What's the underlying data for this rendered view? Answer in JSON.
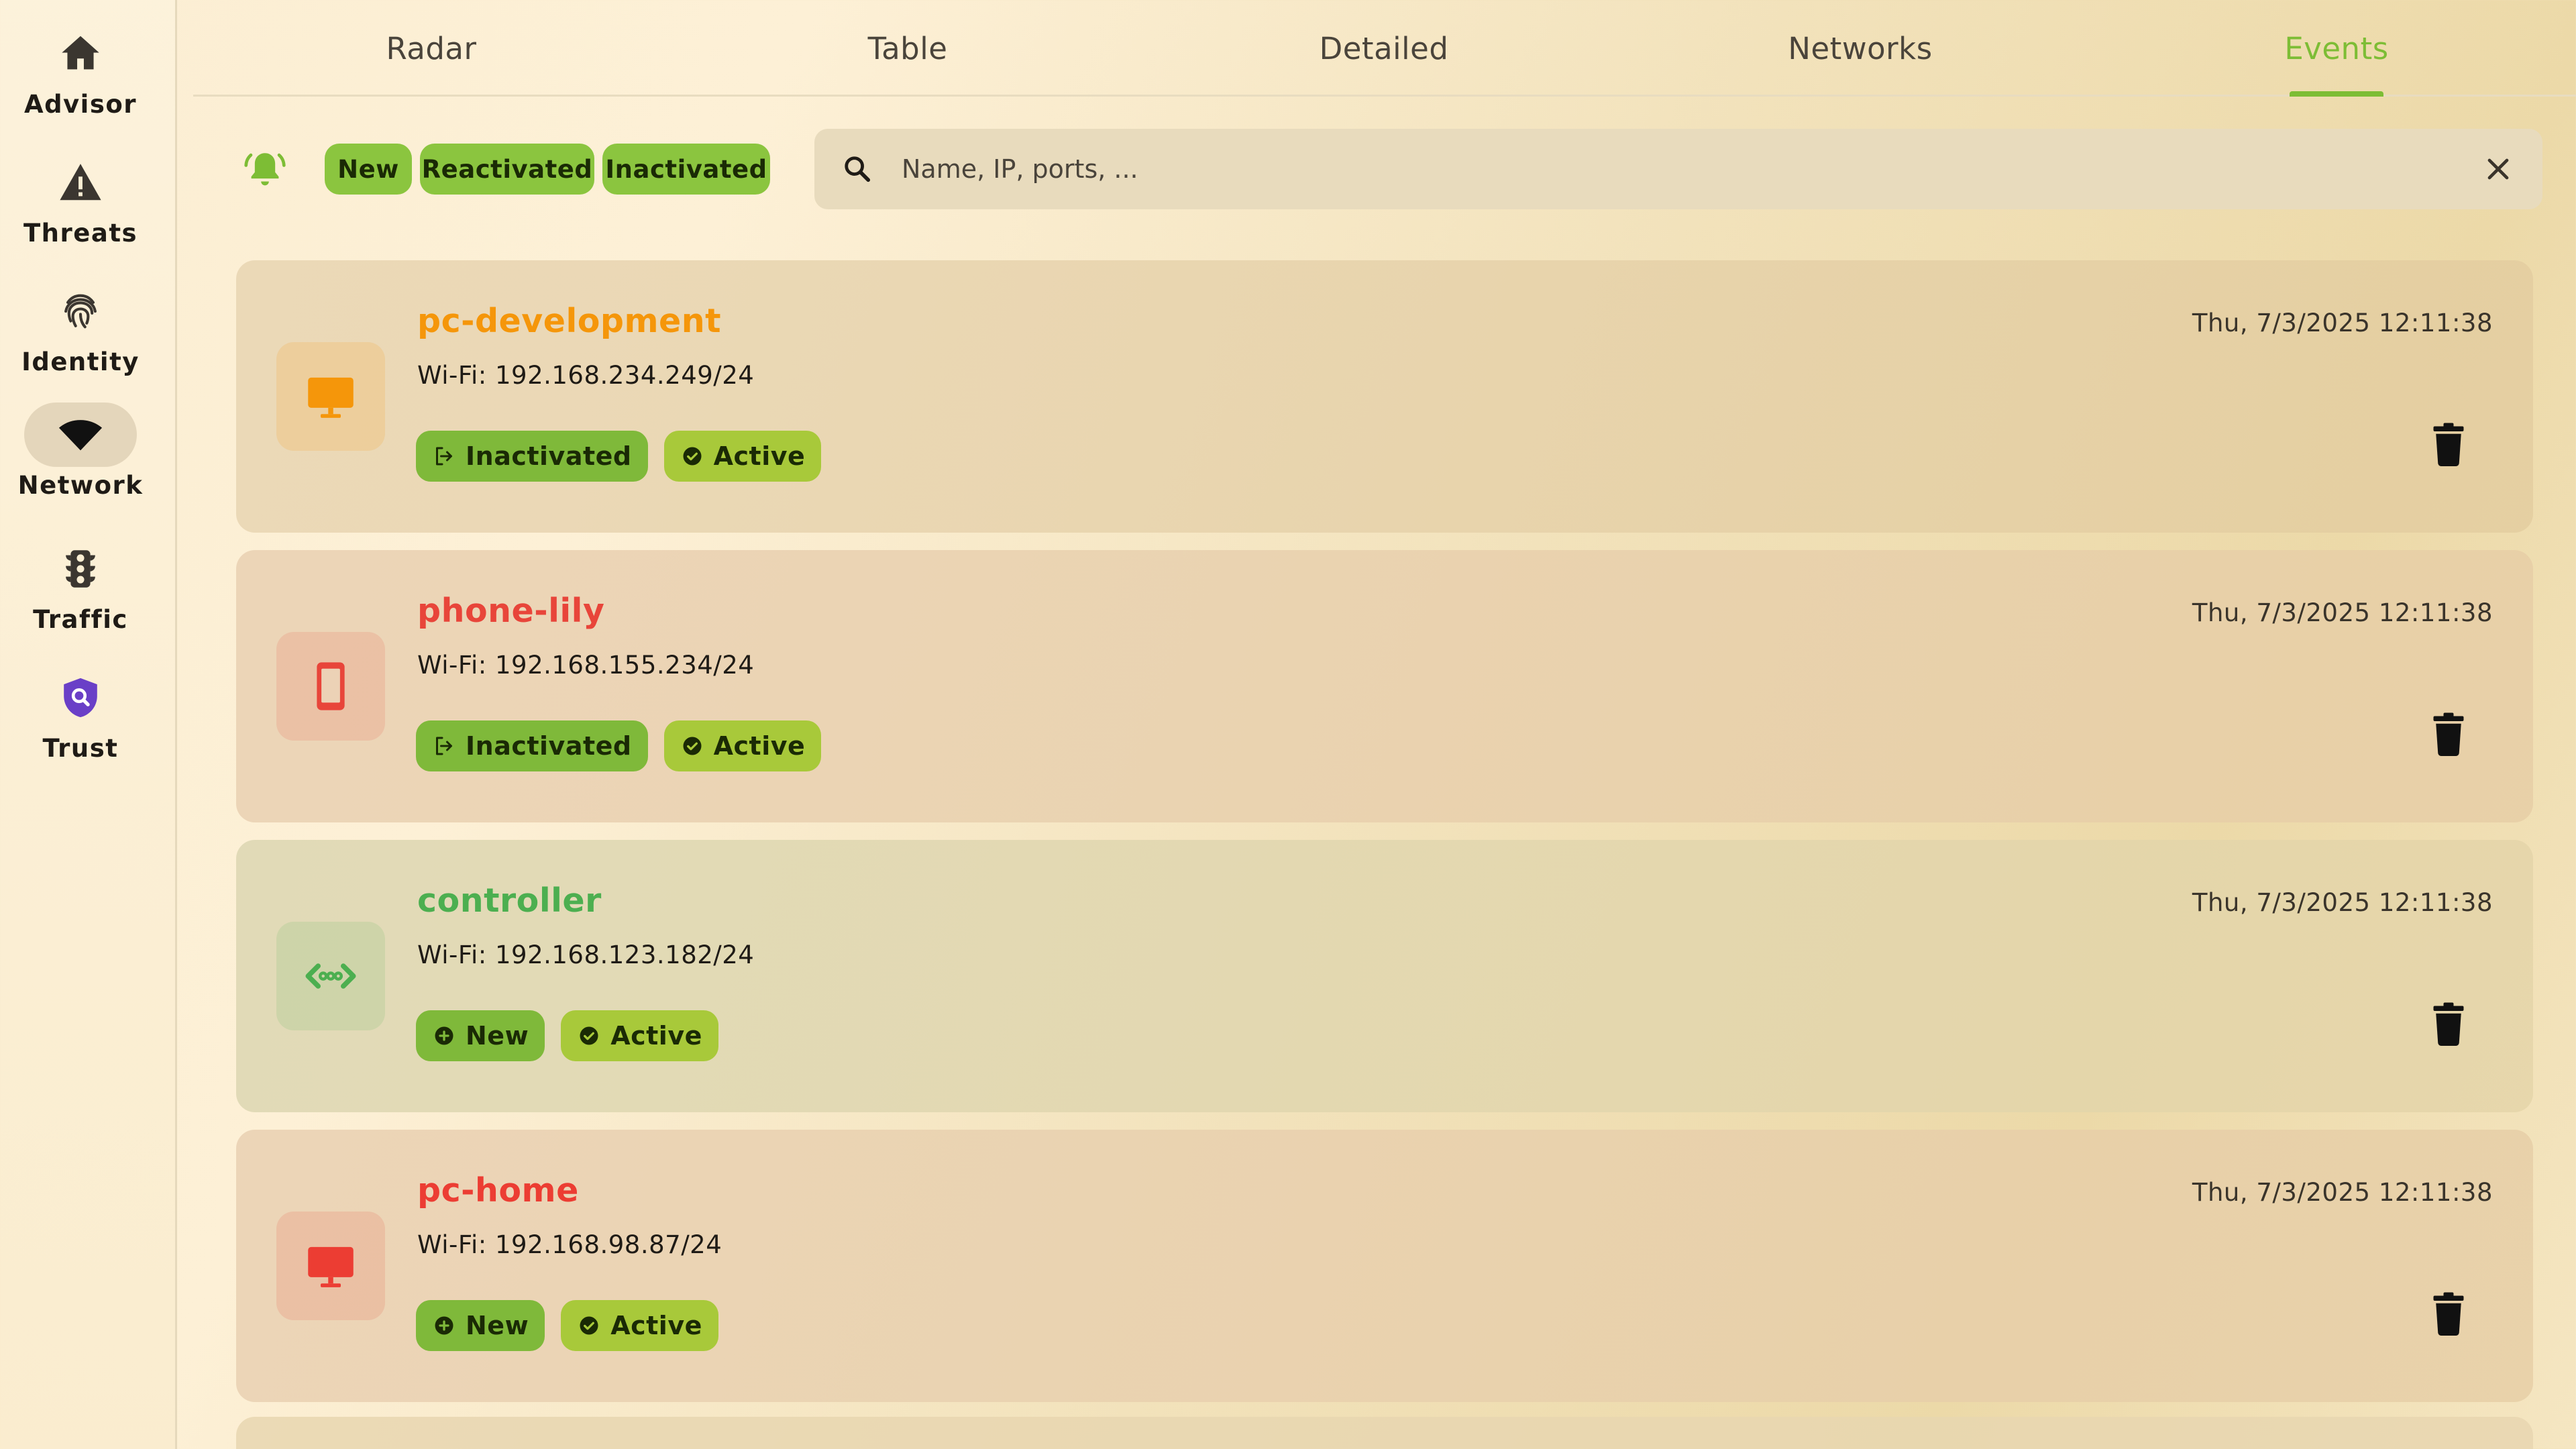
{
  "sidebar": {
    "items": [
      {
        "label": "Advisor",
        "icon": "home-icon"
      },
      {
        "label": "Threats",
        "icon": "warning-icon"
      },
      {
        "label": "Identity",
        "icon": "fingerprint-icon"
      },
      {
        "label": "Network",
        "icon": "wifi-icon",
        "active": true
      },
      {
        "label": "Traffic",
        "icon": "traffic-light-icon"
      },
      {
        "label": "Trust",
        "icon": "shield-search-icon"
      }
    ]
  },
  "tabs": [
    "Radar",
    "Table",
    "Detailed",
    "Networks",
    "Events"
  ],
  "active_tab": "Events",
  "filters": {
    "chips": [
      "New",
      "Reactivated",
      "Inactivated"
    ]
  },
  "search": {
    "placeholder": "Name, IP, ports, ...",
    "value": ""
  },
  "events": [
    {
      "name": "pc-development",
      "ip": "Wi-Fi: 192.168.234.249/24",
      "time": "Thu, 7/3/2025 12:11:38",
      "event_badge": "Inactivated",
      "status_badge": "Active",
      "device_icon": "desktop-icon",
      "color": "#f5960a"
    },
    {
      "name": "phone-lily",
      "ip": "Wi-Fi: 192.168.155.234/24",
      "time": "Thu, 7/3/2025 12:11:38",
      "event_badge": "Inactivated",
      "status_badge": "Active",
      "device_icon": "phone-icon",
      "color": "#e8453a"
    },
    {
      "name": "controller",
      "ip": "Wi-Fi: 192.168.123.182/24",
      "time": "Thu, 7/3/2025 12:11:38",
      "event_badge": "New",
      "status_badge": "Active",
      "device_icon": "code-arrows-icon",
      "color": "#4caf50"
    },
    {
      "name": "pc-home",
      "ip": "Wi-Fi: 192.168.98.87/24",
      "time": "Thu, 7/3/2025 12:11:38",
      "event_badge": "New",
      "status_badge": "Active",
      "device_icon": "desktop-icon",
      "color": "#ec3d33"
    }
  ],
  "colors": {
    "accent": "#7dbd35",
    "chip": "#8bc53f",
    "status_badge": "#a8c93a"
  }
}
